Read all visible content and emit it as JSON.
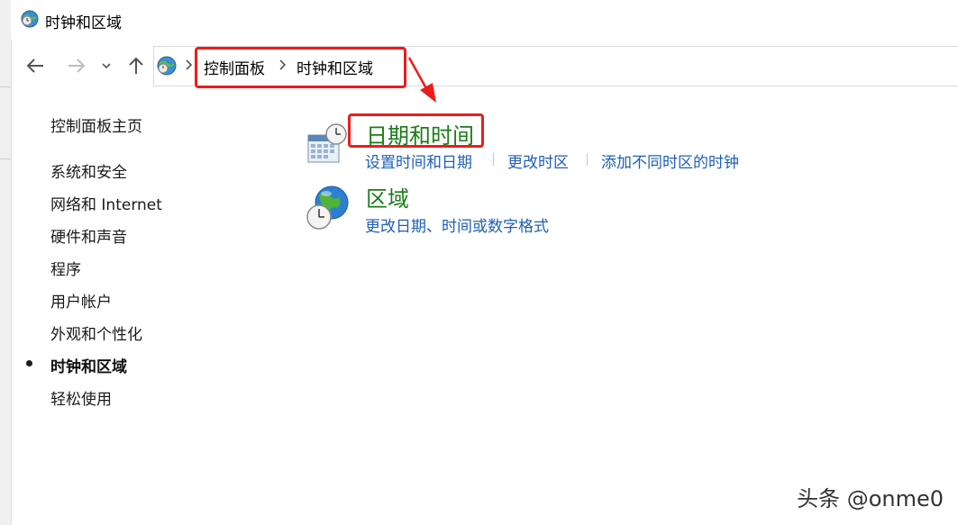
{
  "window": {
    "title": "时钟和区域",
    "icon": "clock-globe-icon"
  },
  "navigation": {
    "back_icon": "back-arrow-icon",
    "forward_icon": "forward-arrow-icon",
    "recent_icon": "chevron-down-icon",
    "up_icon": "up-arrow-icon"
  },
  "address_bar": {
    "breadcrumbs": [
      "控制面板",
      "时钟和区域"
    ]
  },
  "sidebar": {
    "home": "控制面板主页",
    "items": [
      "系统和安全",
      "网络和 Internet",
      "硬件和声音",
      "程序",
      "用户帐户",
      "外观和个性化",
      "时钟和区域",
      "轻松使用"
    ],
    "active_item": "时钟和区域"
  },
  "categories": [
    {
      "title": "日期和时间",
      "icon": "calendar-clock-icon",
      "links": [
        "设置时间和日期",
        "更改时区",
        "添加不同时区的时钟"
      ]
    },
    {
      "title": "区域",
      "icon": "globe-clock-icon",
      "links": [
        "更改日期、时间或数字格式"
      ]
    }
  ],
  "colors": {
    "category_title": "#1a7c1a",
    "link": "#1f5fb4",
    "annotation": "#ee1c1c"
  },
  "watermark": "头条 @onme0"
}
